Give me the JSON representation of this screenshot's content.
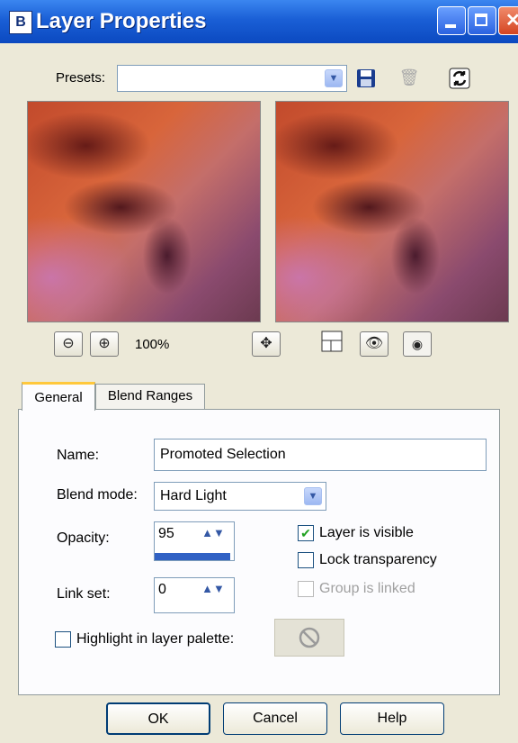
{
  "window": {
    "title": "Layer Properties",
    "app_icon_glyph": "B"
  },
  "presets": {
    "label": "Presets:",
    "value": ""
  },
  "preview": {
    "zoom": "100%"
  },
  "tabs": [
    {
      "label": "General"
    },
    {
      "label": "Blend Ranges"
    }
  ],
  "general": {
    "name_label": "Name:",
    "name_value": "Promoted Selection",
    "blend_mode_label": "Blend mode:",
    "blend_mode_value": "Hard Light",
    "opacity_label": "Opacity:",
    "opacity_value": "95",
    "link_set_label": "Link set:",
    "link_set_value": "0",
    "layer_visible_label": "Layer is visible",
    "layer_visible_checked": true,
    "lock_transparency_label": "Lock transparency",
    "lock_transparency_checked": false,
    "group_linked_label": "Group is linked",
    "group_linked_checked": false,
    "highlight_label": "Highlight in layer palette:",
    "highlight_checked": false
  },
  "buttons": {
    "ok": "OK",
    "cancel": "Cancel",
    "help": "Help"
  },
  "colors": {
    "titlebar": "#0b49c0",
    "accent_tab": "#ffc83c",
    "opacity_bar": "#3161c4"
  }
}
